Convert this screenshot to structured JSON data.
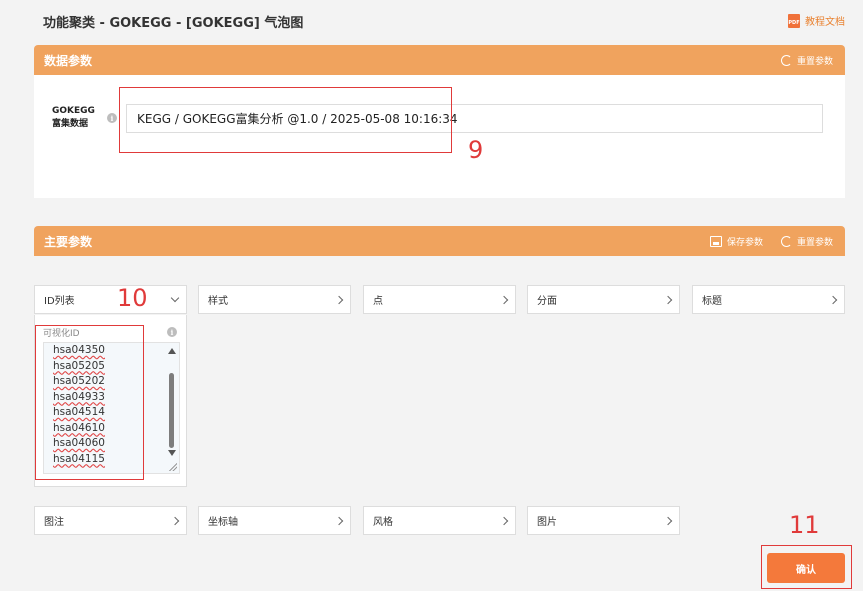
{
  "page": {
    "title": "功能聚类 - GOKEGG - [GOKEGG] 气泡图",
    "doc_link": "教程文档",
    "pdf_badge": "PDF"
  },
  "data_panel": {
    "title": "数据参数",
    "reset_label": "重置参数",
    "field_label_line1": "GOKEGG",
    "field_label_line2": "富集数据",
    "field_value": "KEGG / GOKEGG富集分析 @1.0 / 2025-05-08 10:16:34"
  },
  "main_panel": {
    "title": "主要参数",
    "save_label": "保存参数",
    "reset_label": "重置参数",
    "tiles_row1": [
      "ID列表",
      "样式",
      "点",
      "分面",
      "标题"
    ],
    "tiles_row2": [
      "图注",
      "坐标轴",
      "风格",
      "图片"
    ],
    "idlist": {
      "label": "可视化ID",
      "items": [
        "hsa04350",
        "hsa05205",
        "hsa05202",
        "hsa04933",
        "hsa04514",
        "hsa04610",
        "hsa04060",
        "hsa04115"
      ]
    }
  },
  "confirm_label": "确认",
  "annotations": {
    "n9": "9",
    "n10": "10",
    "n11": "11"
  },
  "colors": {
    "accent": "#f0a35e",
    "button": "#f4793b",
    "highlight": "#e03a3a"
  }
}
